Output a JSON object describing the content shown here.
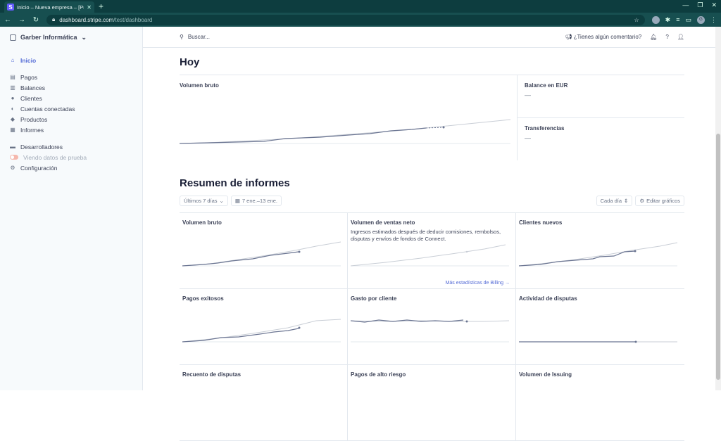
{
  "browser": {
    "tab_title": "Inicio – Nueva empresa – [Pru",
    "url_host": "dashboard.stripe.com",
    "url_path": "/test/dashboard",
    "profile_initial": "G"
  },
  "sidebar": {
    "account_name": "Garber Informática",
    "items": [
      {
        "label": "Inicio",
        "icon": "home-icon"
      },
      {
        "label": "Pagos",
        "icon": "payments-icon"
      },
      {
        "label": "Balances",
        "icon": "balances-icon"
      },
      {
        "label": "Clientes",
        "icon": "customers-icon"
      },
      {
        "label": "Cuentas conectadas",
        "icon": "connect-icon"
      },
      {
        "label": "Productos",
        "icon": "products-icon"
      },
      {
        "label": "Informes",
        "icon": "reports-icon"
      },
      {
        "label": "Desarrolladores",
        "icon": "developers-icon"
      },
      {
        "label": "Viendo datos de prueba",
        "icon": "test-toggle"
      },
      {
        "label": "Configuración",
        "icon": "gear-icon"
      }
    ]
  },
  "topbar": {
    "search_placeholder": "Buscar...",
    "feedback": "¿Tienes algún comentario?"
  },
  "today": {
    "title": "Hoy",
    "gross_volume": "Volumen bruto",
    "balance_label": "Balance en EUR",
    "balance_value": "—",
    "transfers_label": "Transferencias",
    "transfers_value": "—"
  },
  "reports": {
    "title": "Resumen de informes",
    "range_select": "Últimos 7 días",
    "date_range": "7 ene.–13 ene.",
    "interval_select": "Cada día",
    "edit_charts": "Editar gráficos",
    "cards": [
      {
        "title": "Volumen bruto",
        "desc": "",
        "link": ""
      },
      {
        "title": "Volumen de ventas neto",
        "desc": "Ingresos estimados después de deducir comisiones, rembolsos, disputas y envíos de fondos de Connect.",
        "link": "Más estadísticas de Billing →"
      },
      {
        "title": "Clientes nuevos",
        "desc": "",
        "link": ""
      },
      {
        "title": "Pagos exitosos",
        "desc": "",
        "link": ""
      },
      {
        "title": "Gasto por cliente",
        "desc": "",
        "link": ""
      },
      {
        "title": "Actividad de disputas",
        "desc": "",
        "link": ""
      },
      {
        "title": "Recuento de disputas",
        "desc": "",
        "link": ""
      },
      {
        "title": "Pagos de alto riesgo",
        "desc": "",
        "link": ""
      },
      {
        "title": "Volumen de Issuing",
        "desc": "",
        "link": ""
      }
    ]
  },
  "colors": {
    "accent": "#556cd6",
    "line": "#6b7592",
    "line_light": "#c9ced6"
  }
}
